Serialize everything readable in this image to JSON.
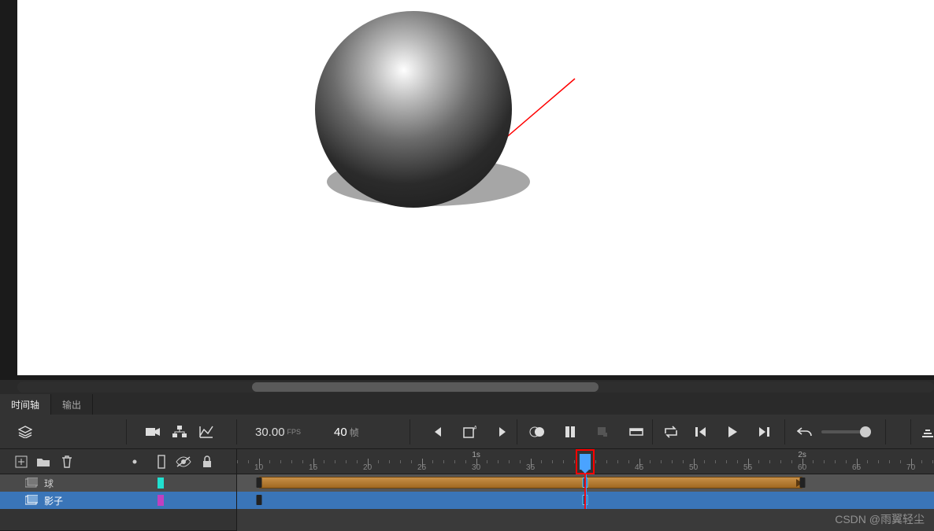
{
  "tabs": {
    "timeline": "时间轴",
    "output": "输出"
  },
  "toolbar": {
    "fps_value": "30.00",
    "fps_label": "FPS",
    "frame_value": "40",
    "frame_label": "帧"
  },
  "ruler": {
    "seconds": [
      {
        "label": "1s",
        "frame": 30
      },
      {
        "label": "2s",
        "frame": 60
      }
    ],
    "numbers": [
      10,
      15,
      20,
      25,
      30,
      35,
      40,
      45,
      50,
      55,
      60,
      65,
      70
    ]
  },
  "layers": [
    {
      "name": "球",
      "color": "#20e0d0",
      "selected": false
    },
    {
      "name": "影子",
      "color": "#c040c0",
      "selected": true
    }
  ],
  "timeline": {
    "current_frame": 40,
    "tracks": [
      {
        "span": {
          "start": 10,
          "end": 60
        },
        "keyframes": [
          10,
          40,
          60
        ]
      },
      {
        "span": null,
        "keyframes": [
          10,
          40
        ]
      }
    ]
  },
  "watermark": "CSDN @雨翼轻尘"
}
